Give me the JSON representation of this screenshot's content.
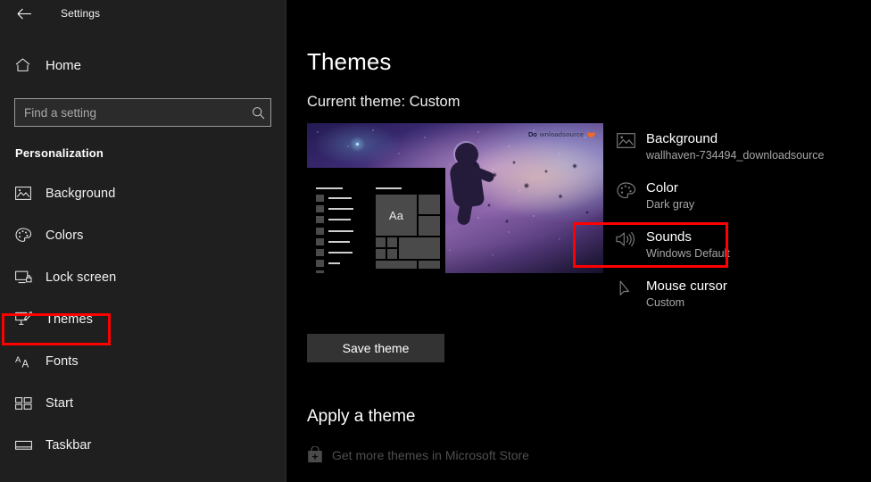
{
  "window": {
    "title": "Settings",
    "back_icon": "back-arrow-icon"
  },
  "sidebar": {
    "home": {
      "label": "Home",
      "icon": "home-icon"
    },
    "search": {
      "value": "",
      "placeholder": "Find a setting",
      "icon": "search-icon"
    },
    "category": "Personalization",
    "items": [
      {
        "label": "Background",
        "icon": "picture-icon",
        "selected": false
      },
      {
        "label": "Colors",
        "icon": "palette-icon",
        "selected": false
      },
      {
        "label": "Lock screen",
        "icon": "lock-screen-icon",
        "selected": false
      },
      {
        "label": "Themes",
        "icon": "themes-brush-icon",
        "selected": true
      },
      {
        "label": "Fonts",
        "icon": "fonts-aa-icon",
        "selected": false
      },
      {
        "label": "Start",
        "icon": "start-tiles-icon",
        "selected": false
      },
      {
        "label": "Taskbar",
        "icon": "taskbar-icon",
        "selected": false
      }
    ]
  },
  "main": {
    "page_title": "Themes",
    "current_theme": "Current theme: Custom",
    "preview": {
      "mockup_sample_text": "Aa",
      "watermark": {
        "part1": "Do",
        "part2": "wnloadsource"
      }
    },
    "properties": [
      {
        "title": "Background",
        "value": "wallhaven-734494_downloadsource",
        "icon": "picture-icon",
        "highlighted": false
      },
      {
        "title": "Color",
        "value": "Dark gray",
        "icon": "palette-icon",
        "highlighted": false
      },
      {
        "title": "Sounds",
        "value": "Windows Default",
        "icon": "speaker-icon",
        "highlighted": true
      },
      {
        "title": "Mouse cursor",
        "value": "Custom",
        "icon": "mouse-cursor-icon",
        "highlighted": false
      }
    ],
    "save_theme_label": "Save theme",
    "apply_heading": "Apply a theme",
    "store_link": {
      "label": "Get more themes in Microsoft Store",
      "icon": "microsoft-store-icon"
    }
  },
  "colors": {
    "sidebar_bg": "#1f1f1f",
    "main_bg": "#000000",
    "highlight": "#ff0000",
    "text_primary": "#ffffff",
    "text_secondary": "#a6a6a6",
    "button_bg": "#333333"
  }
}
